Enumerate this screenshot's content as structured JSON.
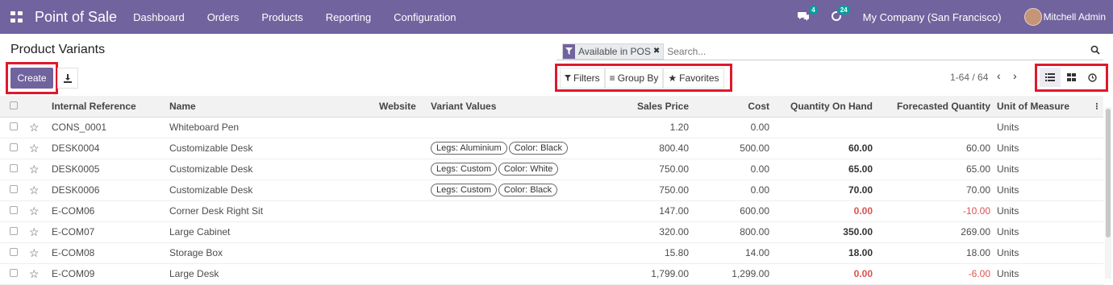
{
  "nav": {
    "brand": "Point of Sale",
    "items": [
      "Dashboard",
      "Orders",
      "Products",
      "Reporting",
      "Configuration"
    ],
    "messages_badge": "4",
    "activity_badge": "24",
    "company": "My Company (San Francisco)",
    "user": "Mitchell Admin"
  },
  "page": {
    "title": "Product Variants",
    "create_label": "Create"
  },
  "search": {
    "facet": "Available in POS",
    "placeholder": "Search..."
  },
  "filters": {
    "filters_label": "Filters",
    "group_by_label": "Group By",
    "favorites_label": "Favorites"
  },
  "pager": {
    "text": "1-64 / 64"
  },
  "table": {
    "headers": {
      "ref": "Internal Reference",
      "name": "Name",
      "website": "Website",
      "variants": "Variant Values",
      "price": "Sales Price",
      "cost": "Cost",
      "qty": "Quantity On Hand",
      "forecast": "Forecasted Quantity",
      "uom": "Unit of Measure"
    },
    "rows": [
      {
        "ref": "CONS_0001",
        "name": "Whiteboard Pen",
        "variants": [],
        "price": "1.20",
        "cost": "0.00",
        "qty": "",
        "forecast": "",
        "uom": "Units"
      },
      {
        "ref": "DESK0004",
        "name": "Customizable Desk",
        "variants": [
          "Legs: Aluminium",
          "Color: Black"
        ],
        "price": "800.40",
        "cost": "500.00",
        "qty": "60.00",
        "forecast": "60.00",
        "uom": "Units"
      },
      {
        "ref": "DESK0005",
        "name": "Customizable Desk",
        "variants": [
          "Legs: Custom",
          "Color: White"
        ],
        "price": "750.00",
        "cost": "0.00",
        "qty": "65.00",
        "forecast": "65.00",
        "uom": "Units"
      },
      {
        "ref": "DESK0006",
        "name": "Customizable Desk",
        "variants": [
          "Legs: Custom",
          "Color: Black"
        ],
        "price": "750.00",
        "cost": "0.00",
        "qty": "70.00",
        "forecast": "70.00",
        "uom": "Units"
      },
      {
        "ref": "E-COM06",
        "name": "Corner Desk Right Sit",
        "variants": [],
        "price": "147.00",
        "cost": "600.00",
        "qty": "0.00",
        "forecast": "-10.00",
        "uom": "Units",
        "negative": true
      },
      {
        "ref": "E-COM07",
        "name": "Large Cabinet",
        "variants": [],
        "price": "320.00",
        "cost": "800.00",
        "qty": "350.00",
        "forecast": "269.00",
        "uom": "Units"
      },
      {
        "ref": "E-COM08",
        "name": "Storage Box",
        "variants": [],
        "price": "15.80",
        "cost": "14.00",
        "qty": "18.00",
        "forecast": "18.00",
        "uom": "Units"
      },
      {
        "ref": "E-COM09",
        "name": "Large Desk",
        "variants": [],
        "price": "1,799.00",
        "cost": "1,299.00",
        "qty": "0.00",
        "forecast": "-6.00",
        "uom": "Units",
        "negative": true
      }
    ]
  }
}
